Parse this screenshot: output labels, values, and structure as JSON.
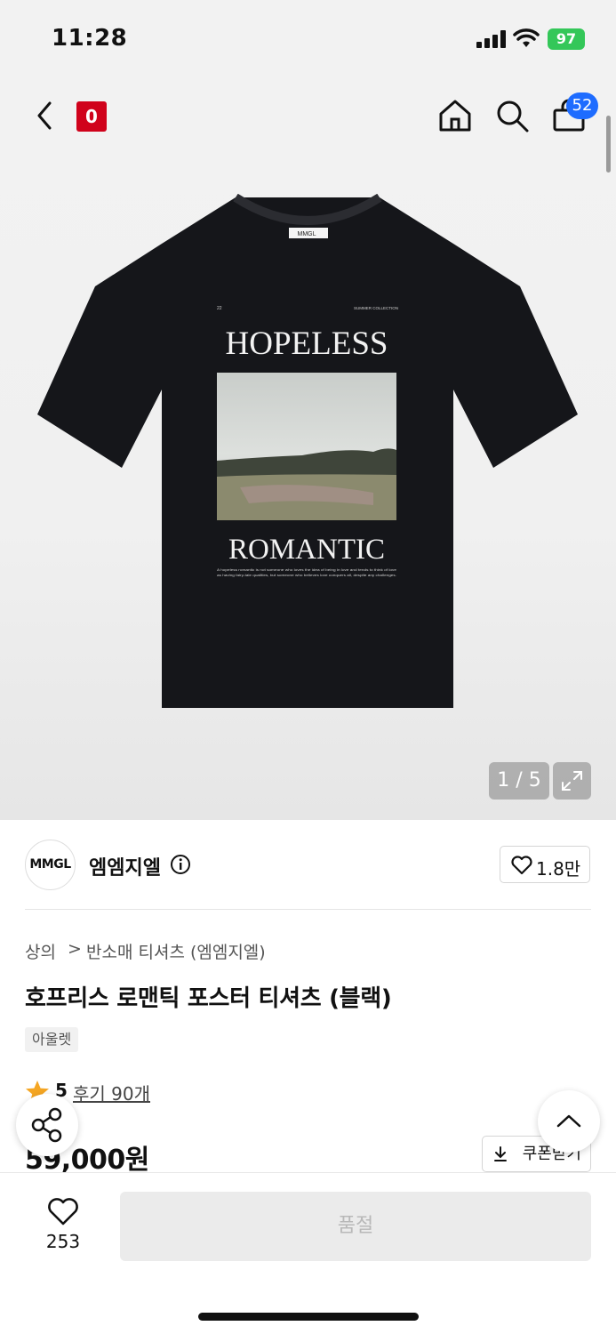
{
  "status_bar": {
    "time": "11:28",
    "battery": "97"
  },
  "header": {
    "brand_badge": "0",
    "cart_count": "52"
  },
  "gallery": {
    "image_counter": "1 / 5",
    "shirt": {
      "tag_label": "MMGL",
      "top_left": "22",
      "top_right": "SUMMER COLLECTION",
      "headline_top": "HOPELESS",
      "headline_bottom": "ROMANTIC",
      "caption_line1": "A hopeless romantic is not someone who loves the idea of being in love and tends to think of love",
      "caption_line2": "as having fairy-tale qualities, but someone who believes love conquers all, despite any challenges."
    }
  },
  "brand": {
    "logo_text": "MMGL",
    "name": "엠엠지엘",
    "likes": "1.8만"
  },
  "breadcrumb": {
    "category": "상의",
    "separator": ">",
    "subcategory": "반소매 티셔츠 (엠엠지엘)"
  },
  "product": {
    "title": "호프리스 로맨틱 포스터 티셔츠 (블랙)",
    "tag": "아울렛",
    "rating": "5",
    "reviews": "후기 90개",
    "price": "59,000원",
    "coupon_label": "쿠폰받기"
  },
  "bottom_bar": {
    "wish_count": "253",
    "soldout_label": "품절"
  },
  "colors": {
    "accent_blue": "#1e6cff",
    "brand_red": "#d0021b",
    "battery_green": "#34c759",
    "star": "#f5a623"
  }
}
